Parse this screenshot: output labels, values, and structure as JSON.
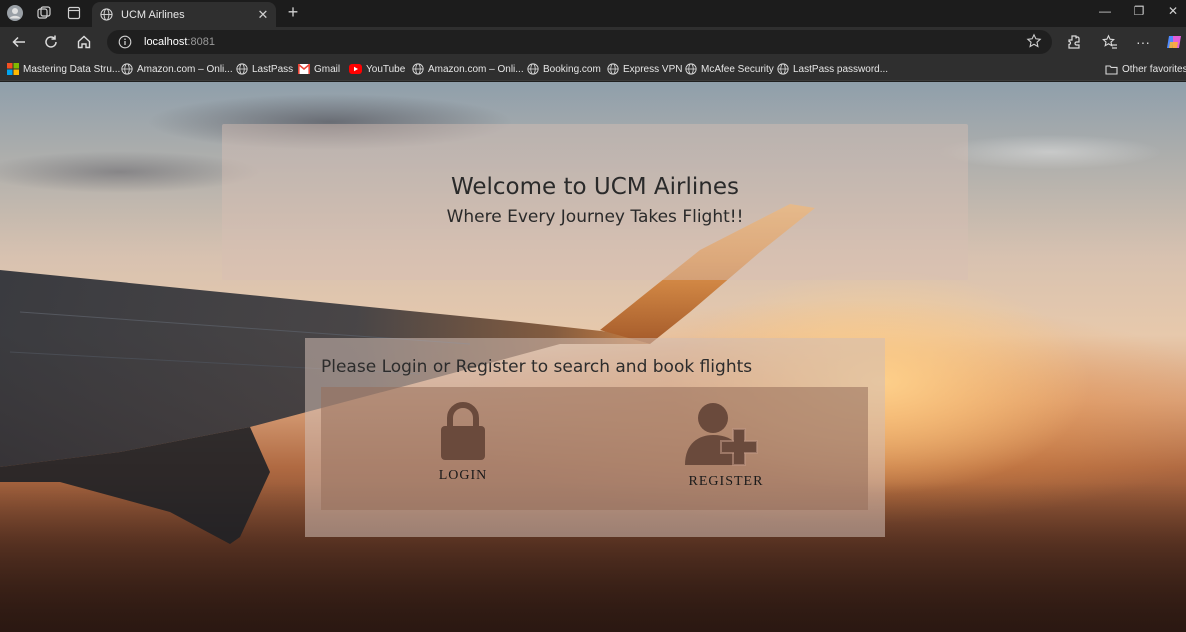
{
  "browser": {
    "tab": {
      "title": "UCM Airlines",
      "icon": "globe-icon"
    },
    "address": {
      "host": "localhost",
      "port": ":8081"
    },
    "bookmarks": [
      {
        "label": "Mastering Data Stru...",
        "icon": "windows-icon"
      },
      {
        "label": "Amazon.com – Onli...",
        "icon": "globe-icon"
      },
      {
        "label": "LastPass",
        "icon": "globe-icon"
      },
      {
        "label": "Gmail",
        "icon": "gmail-icon"
      },
      {
        "label": "YouTube",
        "icon": "youtube-icon"
      },
      {
        "label": "Amazon.com – Onli...",
        "icon": "globe-icon"
      },
      {
        "label": "Booking.com",
        "icon": "globe-icon"
      },
      {
        "label": "Express VPN",
        "icon": "globe-icon"
      },
      {
        "label": "McAfee Security",
        "icon": "globe-icon"
      },
      {
        "label": "LastPass password...",
        "icon": "globe-icon"
      }
    ],
    "other_favorites": "Other favorites"
  },
  "hero": {
    "title": "Welcome to UCM Airlines",
    "subtitle": "Where Every Journey Takes Flight!!"
  },
  "auth": {
    "message": "Please Login or Register to search and book flights",
    "login_label": "LOGIN",
    "register_label": "REGISTER"
  }
}
